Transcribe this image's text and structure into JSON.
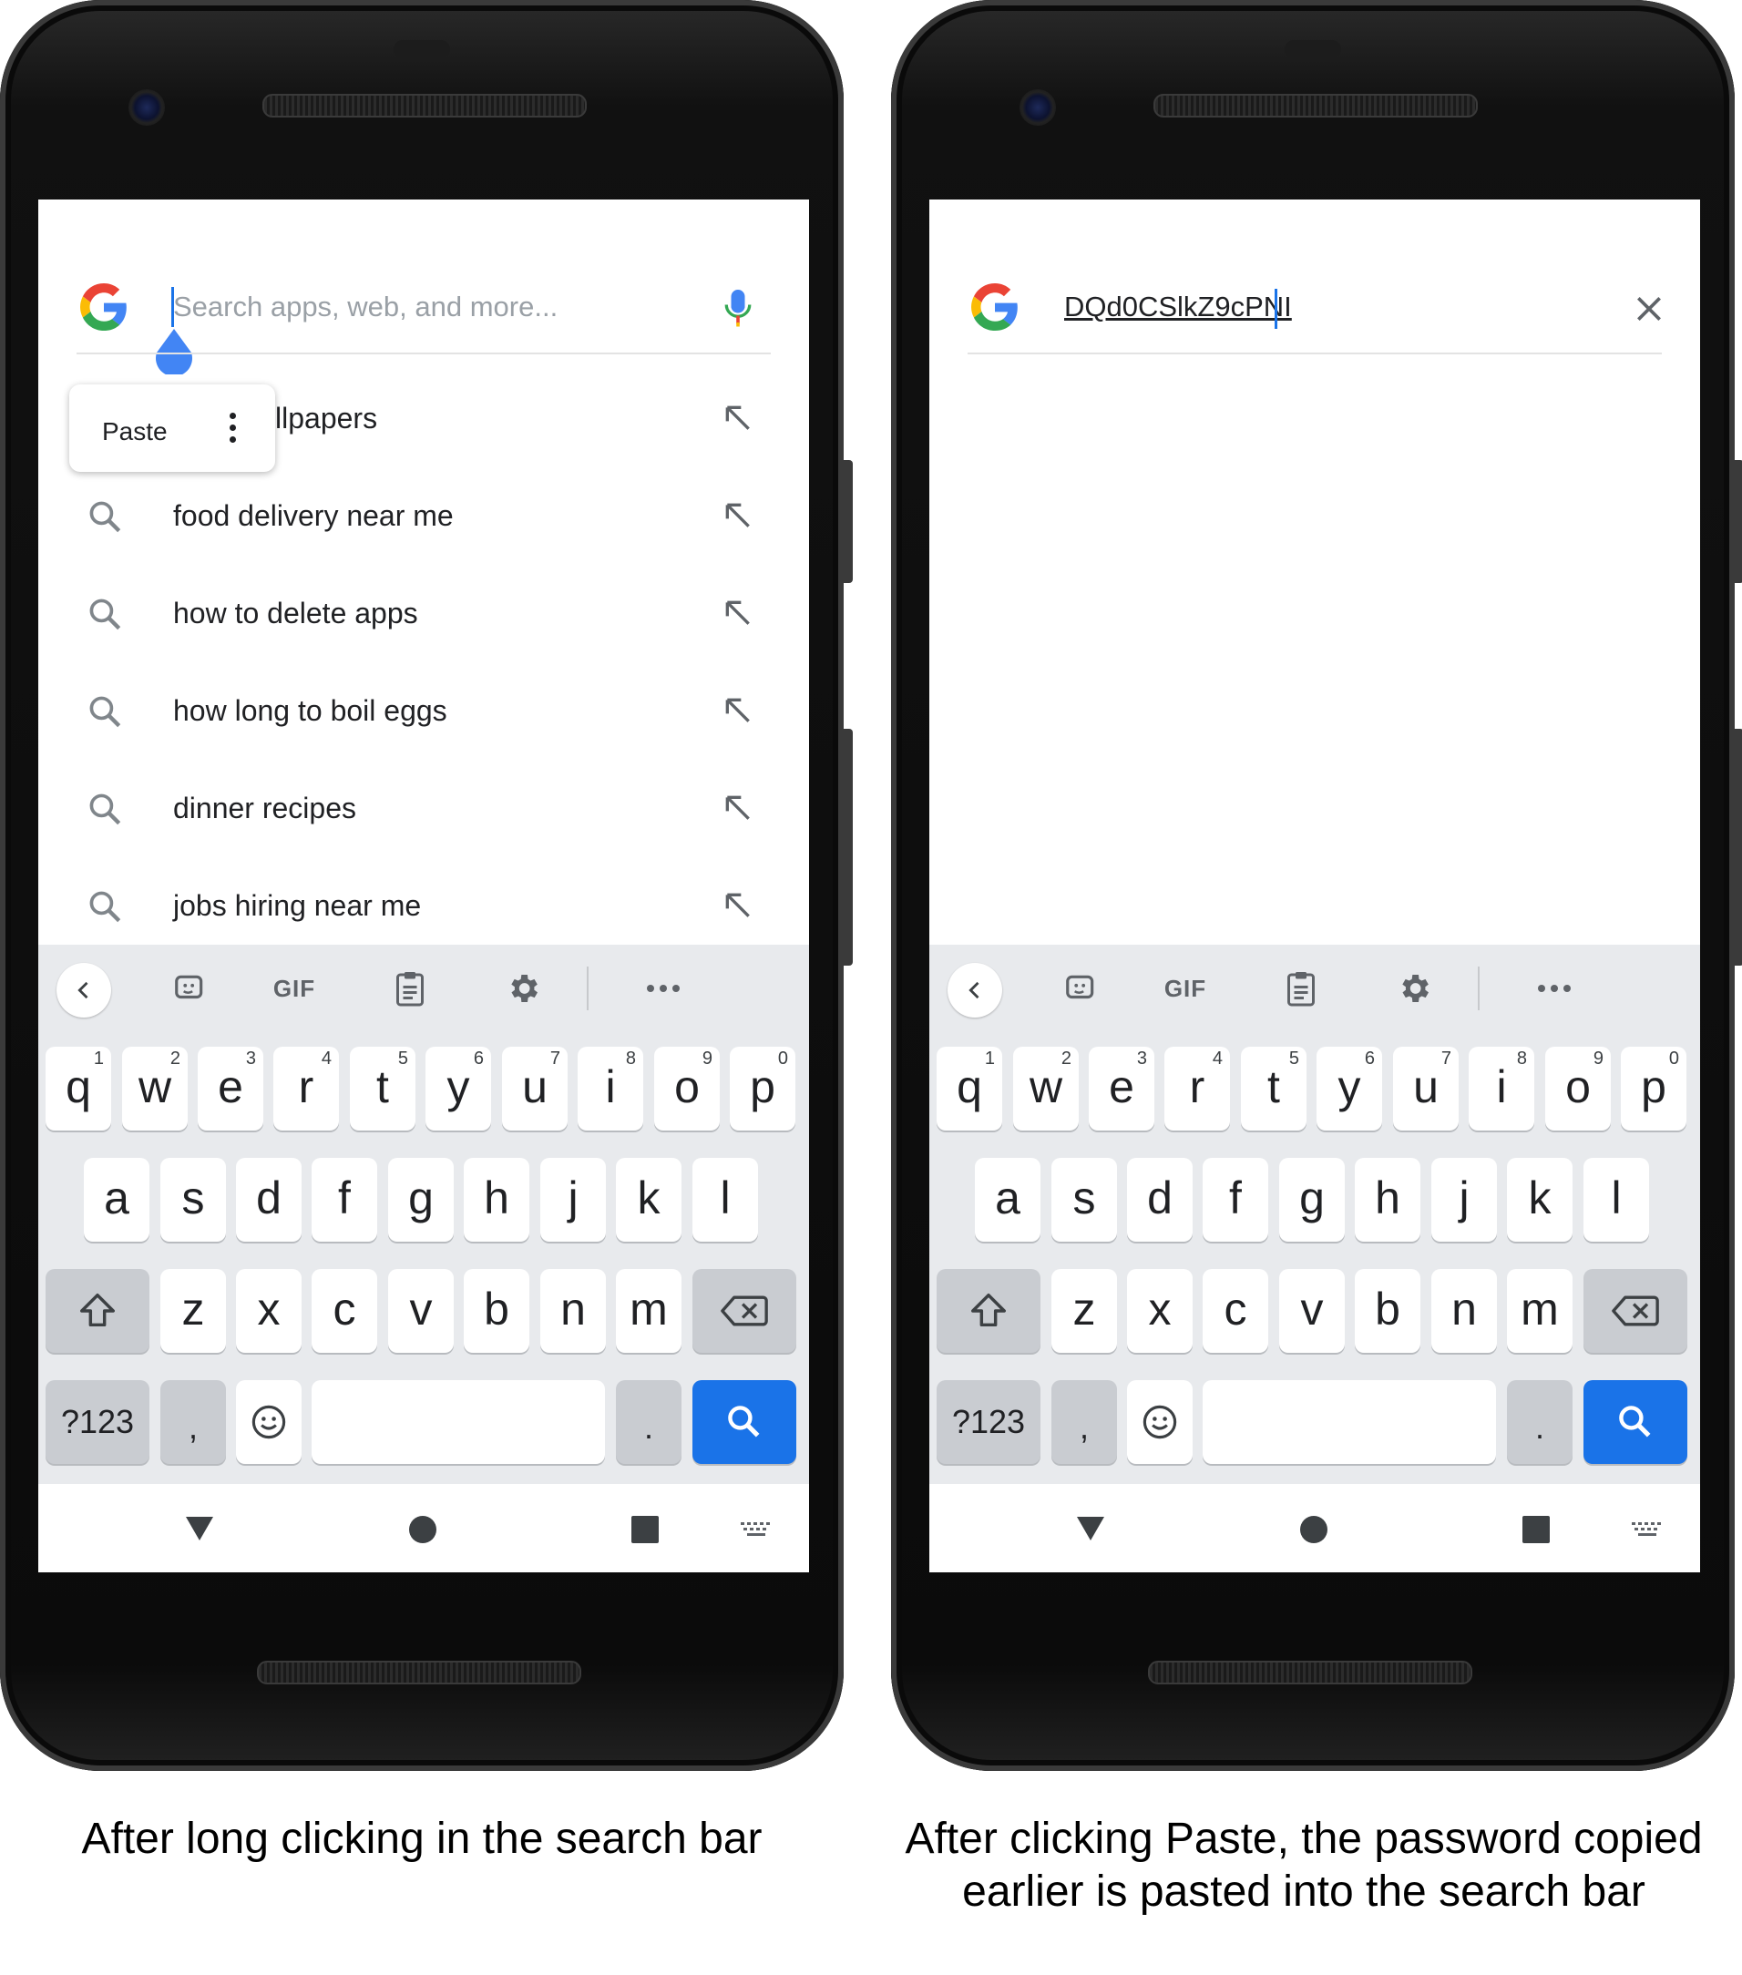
{
  "left_phone": {
    "search_placeholder": "Search apps, web, and more...",
    "context_menu": {
      "paste_label": "Paste"
    },
    "suggestions": [
      {
        "text": "llpapers"
      },
      {
        "text": "food delivery near me"
      },
      {
        "text": "how to delete apps"
      },
      {
        "text": "how long to boil eggs"
      },
      {
        "text": "dinner recipes"
      },
      {
        "text": "jobs hiring near me"
      }
    ]
  },
  "right_phone": {
    "search_query": "DQd0CSlkZ9cPNI"
  },
  "keyboard": {
    "toolbar": {
      "gif_label": "GIF"
    },
    "row1": [
      {
        "k": "q",
        "n": "1"
      },
      {
        "k": "w",
        "n": "2"
      },
      {
        "k": "e",
        "n": "3"
      },
      {
        "k": "r",
        "n": "4"
      },
      {
        "k": "t",
        "n": "5"
      },
      {
        "k": "y",
        "n": "6"
      },
      {
        "k": "u",
        "n": "7"
      },
      {
        "k": "i",
        "n": "8"
      },
      {
        "k": "o",
        "n": "9"
      },
      {
        "k": "p",
        "n": "0"
      }
    ],
    "row2": [
      "a",
      "s",
      "d",
      "f",
      "g",
      "h",
      "j",
      "k",
      "l"
    ],
    "row3": [
      "z",
      "x",
      "c",
      "v",
      "b",
      "n",
      "m"
    ],
    "symbols_label": "?123",
    "comma": ",",
    "period": "."
  },
  "captions": {
    "left": "After long clicking in the search bar",
    "right": "After clicking Paste, the password copied earlier is pasted into the search bar"
  },
  "colors": {
    "accent": "#1a73e8",
    "keyboard_bg": "#e8eaed"
  }
}
